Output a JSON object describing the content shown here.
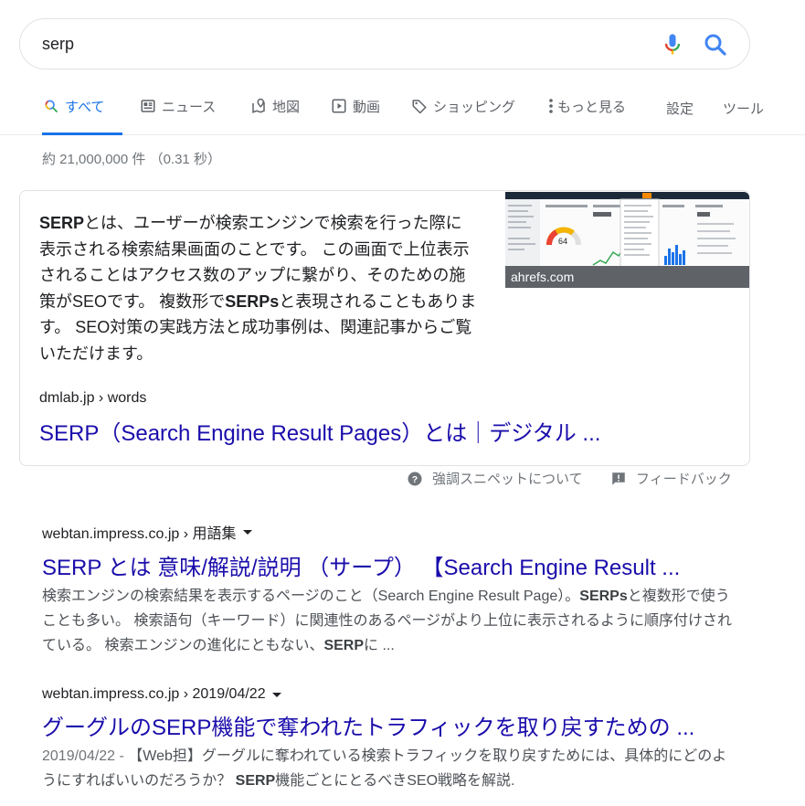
{
  "search": {
    "query": "serp"
  },
  "tabs": [
    {
      "label": "すべて",
      "icon": "search-icon",
      "active": true
    },
    {
      "label": "ニュース",
      "icon": "newspaper-icon"
    },
    {
      "label": "地図",
      "icon": "map-pin-icon"
    },
    {
      "label": "動画",
      "icon": "play-icon"
    },
    {
      "label": "ショッピング",
      "icon": "tag-icon"
    },
    {
      "label": "もっと見る",
      "icon": "more-vert-icon"
    },
    {
      "label": "設定"
    },
    {
      "label": "ツール"
    }
  ],
  "stats": "約 21,000,000 件 （0.31 秒）",
  "featured": {
    "text_segments": [
      {
        "b": "SERP"
      },
      {
        "t": "とは、ユーザーが検索エンジンで検索を行った際に表示される検索結果画面のことです。 この画面で上位表示されることはアクセス数のアップに繋がり、そのための施策がSEOです。 複数形で"
      },
      {
        "b": "SERPs"
      },
      {
        "t": "と表現されることもあります。 SEO対策の実践方法と成功事例は、関連記事からご覧いただけます。"
      }
    ],
    "image_caption": "ahrefs.com",
    "gauge_value": "64",
    "cite": "dmlab.jp › words",
    "title": "SERP（Search Engine Result Pages）とは｜デジタル ..."
  },
  "feedback": {
    "about": "強調スニペットについて",
    "feedback": "フィードバック"
  },
  "results": [
    {
      "cite": "webtan.impress.co.jp › 用語集",
      "title": "SERP とは 意味/解説/説明 （サープ） 【Search Engine Result ...",
      "snippet_segments": [
        {
          "t": "検索エンジンの検索結果を表示するページのこと（Search Engine Result Page）。"
        },
        {
          "b": "SERPs"
        },
        {
          "t": "と複数形で使うことも多い。 検索語句（キーワード）に関連性のあるページがより上位に表示されるように順序付けされている。 検索エンジンの進化にともない、"
        },
        {
          "b": "SERP"
        },
        {
          "t": "に ..."
        }
      ]
    },
    {
      "cite": "webtan.impress.co.jp › 2019/04/22",
      "title": "グーグルのSERP機能で奪われたトラフィックを取り戻すための ...",
      "snippet_segments": [
        {
          "d": "2019/04/22 - "
        },
        {
          "t": "【Web担】グーグルに奪われている検索トラフィックを取り戻すためには、具体的にどのようにすればいいのだろうか？ "
        },
        {
          "b": "SERP"
        },
        {
          "t": "機能ごとにとるべきSEO戦略を解説."
        }
      ]
    }
  ]
}
